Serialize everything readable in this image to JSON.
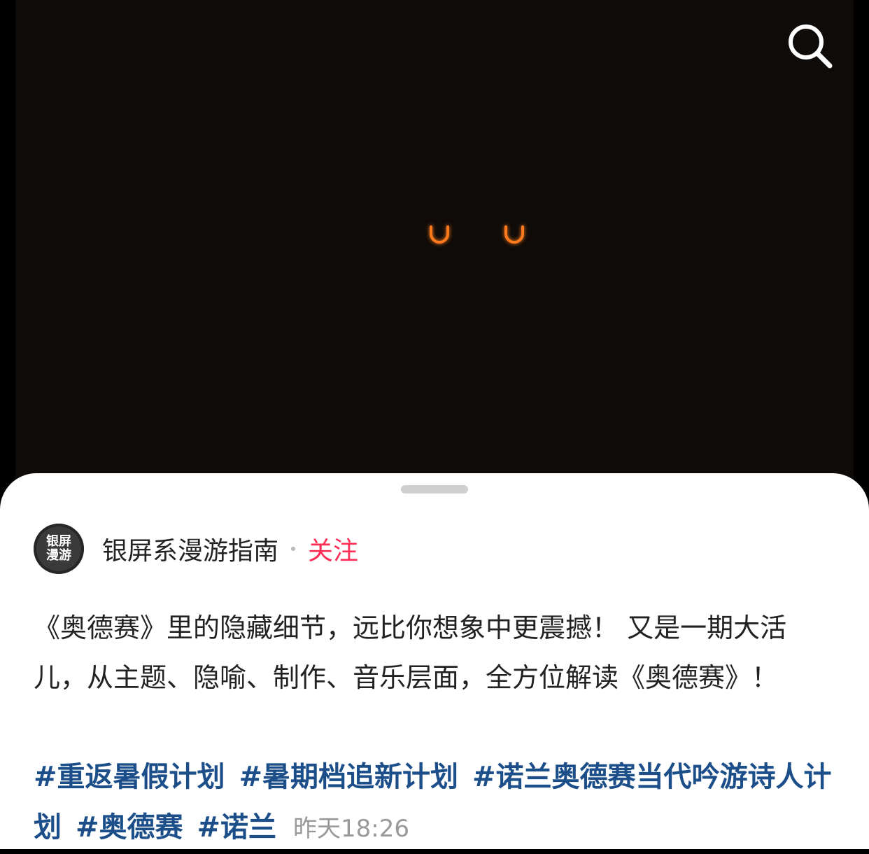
{
  "video": {
    "background": "#0f0b08",
    "glyph_color": "#ff8a1a",
    "search_icon": "search-icon"
  },
  "author": {
    "avatar_line1": "银屏",
    "avatar_line2": "漫游",
    "name": "银屏系漫游指南",
    "follow_label": "关注"
  },
  "post": {
    "description": "《奥德赛》里的隐藏细节，远比你想象中更震撼！ 又是一期大活儿，从主题、隐喻、制作、音乐层面，全方位解读《奥德赛》！",
    "tags": [
      "#重返暑假计划",
      "#暑期档追新计划",
      "#诺兰奥德赛当代吟游诗人计划",
      "#奥德赛",
      "#诺兰"
    ],
    "time": "昨天18:26"
  },
  "colors": {
    "follow": "#ff2d55",
    "tag": "#1c4f8a",
    "time": "#999999"
  }
}
